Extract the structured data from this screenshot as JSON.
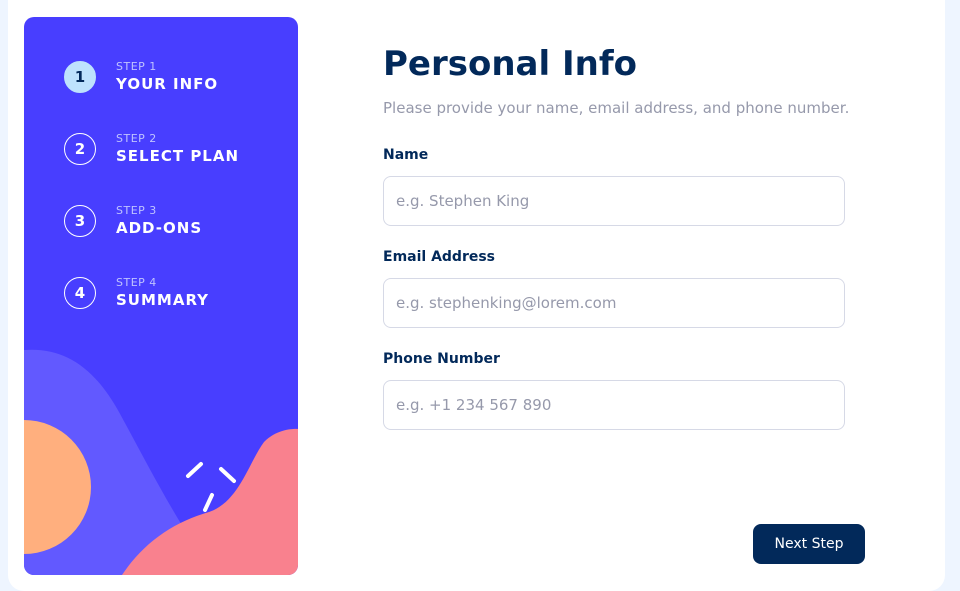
{
  "sidebar": {
    "steps": [
      {
        "label": "STEP 1",
        "title": "YOUR INFO",
        "number": "1",
        "active": true
      },
      {
        "label": "STEP 2",
        "title": "SELECT PLAN",
        "number": "2",
        "active": false
      },
      {
        "label": "STEP 3",
        "title": "ADD-ONS",
        "number": "3",
        "active": false
      },
      {
        "label": "STEP 4",
        "title": "SUMMARY",
        "number": "4",
        "active": false
      }
    ]
  },
  "main": {
    "title": "Personal Info",
    "subtitle": "Please provide your name, email address, and phone number.",
    "fields": {
      "name": {
        "label": "Name",
        "placeholder": "e.g. Stephen King",
        "value": ""
      },
      "email": {
        "label": "Email Address",
        "placeholder": "e.g. stephenking@lorem.com",
        "value": ""
      },
      "phone": {
        "label": "Phone Number",
        "placeholder": "e.g. +1 234 567 890",
        "value": ""
      }
    },
    "next_label": "Next Step"
  },
  "colors": {
    "sidebar_bg": "#483eff",
    "active_step": "#bee2fd",
    "primary_text": "#02295a",
    "muted_text": "#9699ab",
    "border": "#d6d9e6",
    "decor_purple": "#6259ff",
    "decor_orange": "#ffaf7e",
    "decor_pink": "#f9818e"
  }
}
